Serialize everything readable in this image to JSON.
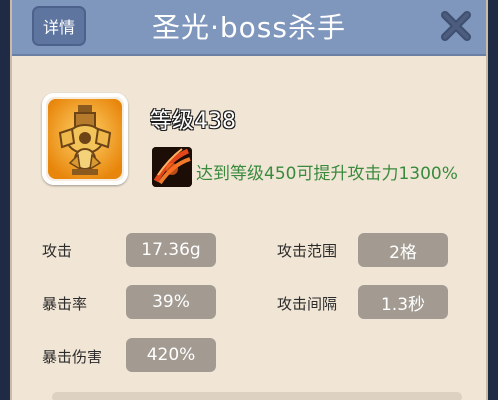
{
  "header": {
    "details_label": "详情",
    "title": "圣光·boss杀手"
  },
  "unit": {
    "level_text": "等级438",
    "skill_text": "达到等级450可提升攻击力1300%"
  },
  "stats": {
    "attack_label": "攻击",
    "attack_value": "17.36g",
    "range_label": "攻击范围",
    "range_value": "2格",
    "crit_rate_label": "暴击率",
    "crit_rate_value": "39%",
    "interval_label": "攻击间隔",
    "interval_value": "1.3秒",
    "crit_damage_label": "暴击伤害",
    "crit_damage_value": "420%"
  },
  "colors": {
    "header": "#7f96bd",
    "panel": "#f1e6d6",
    "value_box": "#a39b92",
    "skill_text": "#3a8a3d"
  },
  "icons": {
    "close": "close-icon",
    "avatar": "tower-avatar-icon",
    "skill": "fire-claw-icon"
  }
}
